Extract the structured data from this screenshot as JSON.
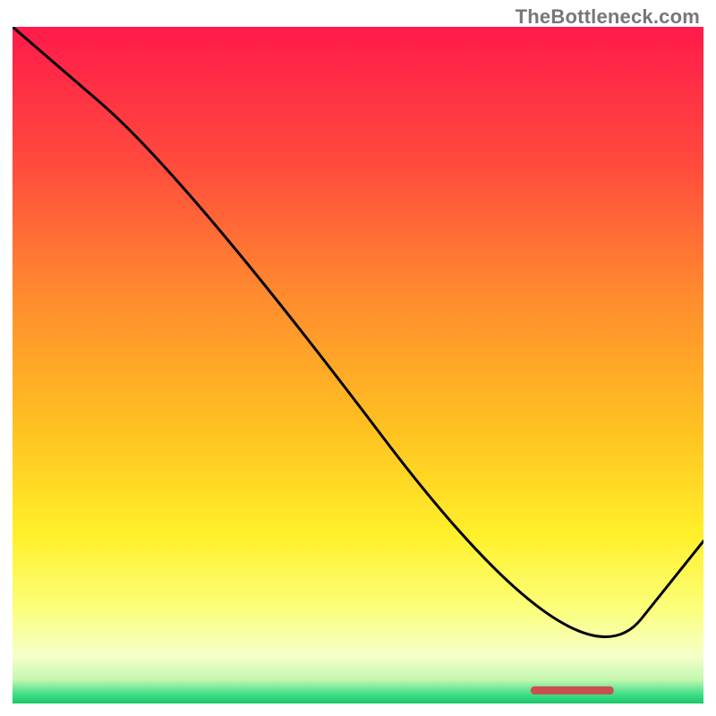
{
  "watermark": "TheBottleneck.com",
  "chart_data": {
    "type": "line",
    "title": "",
    "xlabel": "",
    "ylabel": "",
    "xlim": [
      0,
      100
    ],
    "ylim": [
      0,
      100
    ],
    "grid": false,
    "red_marker": {
      "x_start": 75,
      "x_end": 87,
      "y": 2
    },
    "series": [
      {
        "name": "curve",
        "x": [
          0,
          25,
          82,
          100
        ],
        "y": [
          100,
          78,
          1,
          24
        ]
      }
    ],
    "gradient_stops": [
      {
        "offset": 0.0,
        "color": "#ff1a4b"
      },
      {
        "offset": 0.2,
        "color": "#ff4a3d"
      },
      {
        "offset": 0.4,
        "color": "#ff8c2e"
      },
      {
        "offset": 0.6,
        "color": "#ffc320"
      },
      {
        "offset": 0.75,
        "color": "#fff02a"
      },
      {
        "offset": 0.86,
        "color": "#fbff7a"
      },
      {
        "offset": 0.93,
        "color": "#f6ffc9"
      },
      {
        "offset": 0.965,
        "color": "#c3f7b0"
      },
      {
        "offset": 0.985,
        "color": "#46e089"
      },
      {
        "offset": 1.0,
        "color": "#18c76a"
      }
    ]
  }
}
